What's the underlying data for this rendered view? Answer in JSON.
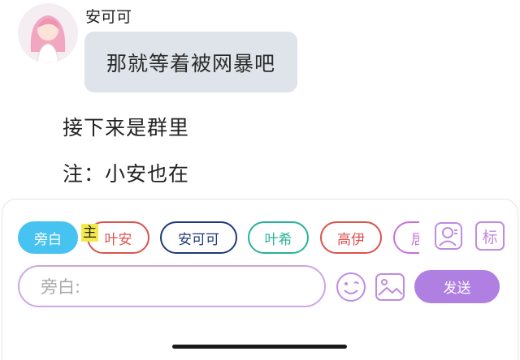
{
  "chat": {
    "sender_name": "安可可",
    "bubble_text": "那就等着被网暴吧",
    "narration_1": "接下来是群里",
    "narration_2": "注：小安也在"
  },
  "composer": {
    "roles": [
      {
        "label": "旁白",
        "selected": true,
        "color": "#47c3f2"
      },
      {
        "label": "叶安",
        "color": "#d9534f"
      },
      {
        "label": "安可可",
        "color": "#1f3a78"
      },
      {
        "label": "叶希",
        "color": "#27b39a"
      },
      {
        "label": "高伊",
        "color": "#d9534f"
      },
      {
        "label": "居",
        "color": "#c770dd"
      }
    ],
    "main_tag": "主",
    "portrait_button_icon": "portrait-icon",
    "tag_button_label": "标",
    "emoji_icon": "emoji-icon",
    "image_icon": "image-icon",
    "input_placeholder": "旁白:",
    "send_label": "发送"
  }
}
